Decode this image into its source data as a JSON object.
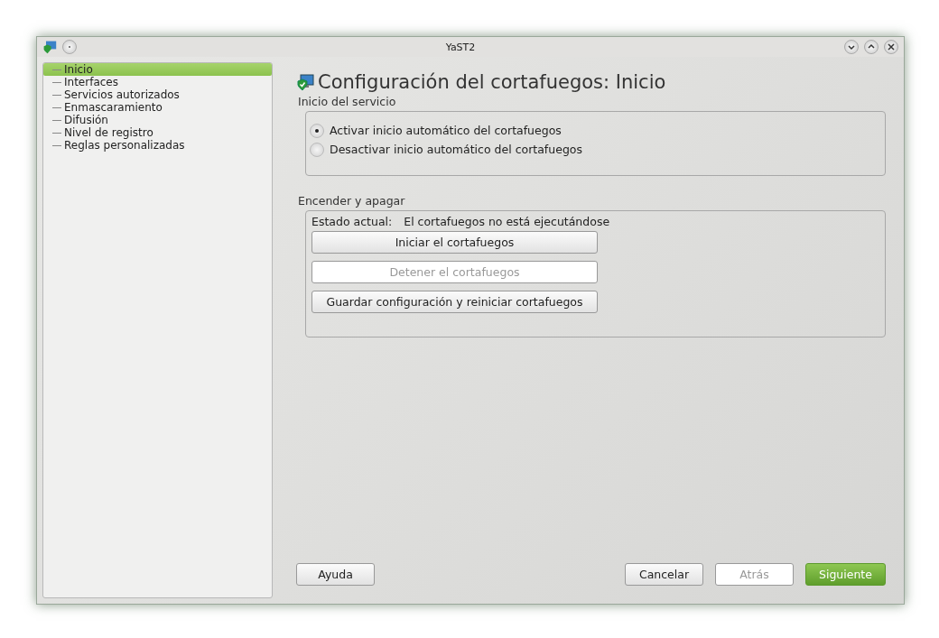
{
  "window": {
    "title": "YaST2"
  },
  "sidebar": {
    "items": [
      {
        "label": "Inicio",
        "selected": true
      },
      {
        "label": "Interfaces",
        "selected": false
      },
      {
        "label": "Servicios autorizados",
        "selected": false
      },
      {
        "label": "Enmascaramiento",
        "selected": false
      },
      {
        "label": "Difusión",
        "selected": false
      },
      {
        "label": "Nivel de registro",
        "selected": false
      },
      {
        "label": "Reglas personalizadas",
        "selected": false
      }
    ]
  },
  "heading": "Configuración del cortafuegos: Inicio",
  "service_start": {
    "title": "Inicio del servicio",
    "options": [
      {
        "label": "Activar inicio automático del cortafuegos",
        "selected": true
      },
      {
        "label": "Desactivar inicio automático del cortafuegos",
        "selected": false
      }
    ]
  },
  "power": {
    "title": "Encender y apagar",
    "status_label": "Estado actual:",
    "status_value": "El cortafuegos no está ejecutándose",
    "buttons": [
      {
        "label": "Iniciar el cortafuegos",
        "disabled": false
      },
      {
        "label": "Detener el cortafuegos",
        "disabled": true
      },
      {
        "label": "Guardar configuración y reiniciar cortafuegos",
        "disabled": false
      }
    ]
  },
  "footer": {
    "help": "Ayuda",
    "buttons": [
      {
        "label": "Cancelar",
        "kind": "normal",
        "disabled": false
      },
      {
        "label": "Atrás",
        "kind": "normal",
        "disabled": true
      },
      {
        "label": "Siguiente",
        "kind": "primary",
        "disabled": false
      }
    ]
  }
}
